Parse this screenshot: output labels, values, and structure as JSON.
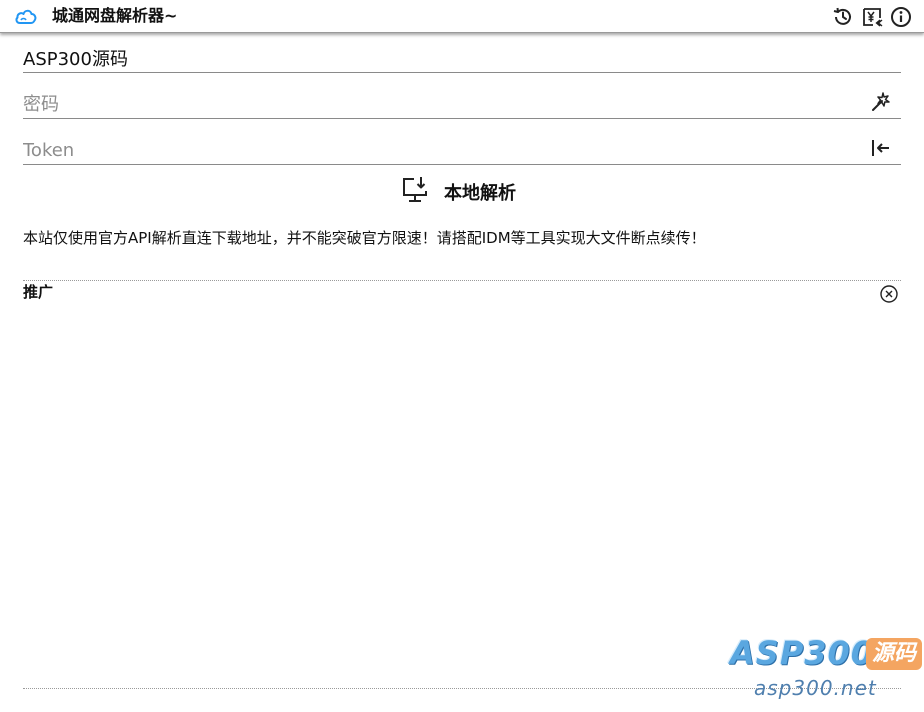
{
  "app": {
    "title": "城通网盘解析器~",
    "icons": [
      "cloud-logo-icon",
      "history-icon",
      "yen-icon",
      "info-icon"
    ]
  },
  "form": {
    "url_field": {
      "value": "ASP300源码",
      "placeholder": ""
    },
    "password_field": {
      "value": "",
      "placeholder": "密码",
      "action_icon": "magic-wand-icon"
    },
    "token_field": {
      "value": "",
      "placeholder": "Token",
      "action_icon": "login-icon"
    },
    "parse_button": {
      "label": "本地解析",
      "icon": "download-monitor-icon"
    }
  },
  "notice": "本站仅使用官方API解析直连下载地址，并不能突破官方限速！请搭配IDM等工具实现大文件断点续传！",
  "promo": {
    "title": "推广",
    "close_icon": "close-circle-icon"
  },
  "watermark": {
    "main": "ASP300",
    "badge": "源码",
    "sub": "asp300.net"
  },
  "colors": {
    "accent": "#2196f3",
    "watermark_blue": "#5aa7e0",
    "watermark_orange": "#f4a561"
  }
}
